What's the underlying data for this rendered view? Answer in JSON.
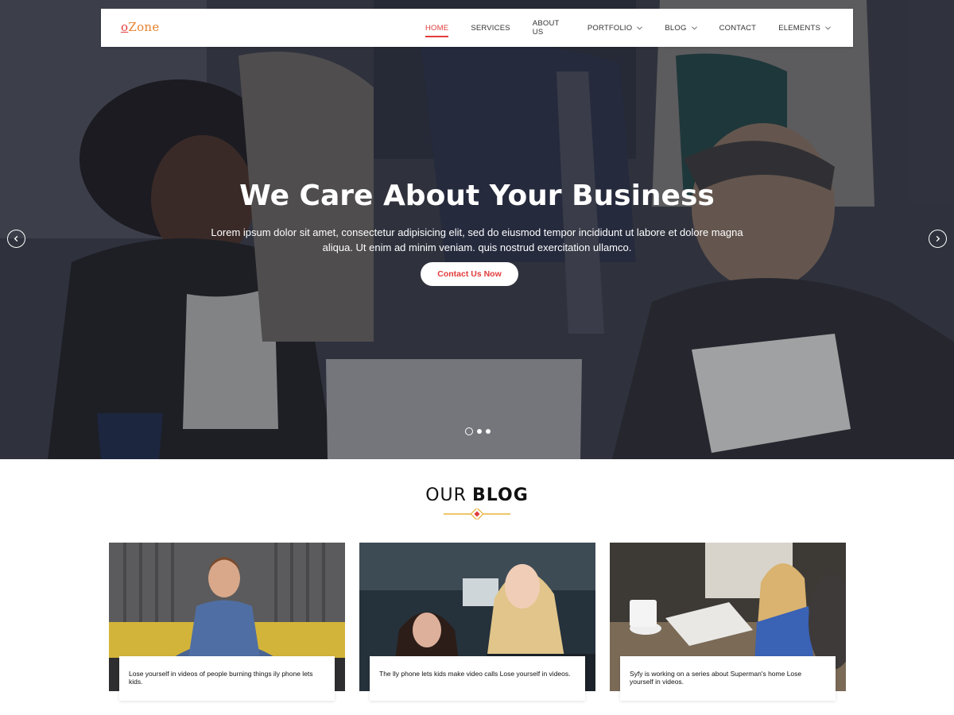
{
  "brand": {
    "logo_first": "o",
    "logo_rest": "Zone"
  },
  "nav": {
    "items": [
      {
        "label": "HOME",
        "active": true,
        "has_dropdown": false
      },
      {
        "label": "SERVICES",
        "active": false,
        "has_dropdown": false
      },
      {
        "label": "ABOUT US",
        "active": false,
        "has_dropdown": false
      },
      {
        "label": "PORTFOLIO",
        "active": false,
        "has_dropdown": true
      },
      {
        "label": "BLOG",
        "active": false,
        "has_dropdown": true
      },
      {
        "label": "CONTACT",
        "active": false,
        "has_dropdown": false
      },
      {
        "label": "ELEMENTS",
        "active": false,
        "has_dropdown": true
      }
    ]
  },
  "hero": {
    "title": "We Care About Your Business",
    "description": "Lorem ipsum dolor sit amet, consectetur adipisicing elit, sed do eiusmod tempor incididunt ut labore et dolore magna aliqua. Ut enim ad minim veniam. quis nostrud exercitation ullamco.",
    "button_label": "Contact Us Now",
    "slide_count": 3,
    "active_slide": 1
  },
  "blog": {
    "heading_thin": "OUR",
    "heading_bold": "BLOG",
    "posts": [
      {
        "text": "Lose yourself in videos of people burning things ily phone lets kids."
      },
      {
        "text": "The lly phone lets kids make video calls Lose yourself in videos."
      },
      {
        "text": "Syfy is working on a series about Superman's home Lose yourself in videos."
      }
    ]
  },
  "colors": {
    "accent": "#e23b3b",
    "logo_orange": "#e8832f",
    "divider_gold": "#e9b43c"
  },
  "icons": {
    "prev": "chevron-left-icon",
    "next": "chevron-right-icon",
    "dropdown": "chevron-down-icon"
  }
}
